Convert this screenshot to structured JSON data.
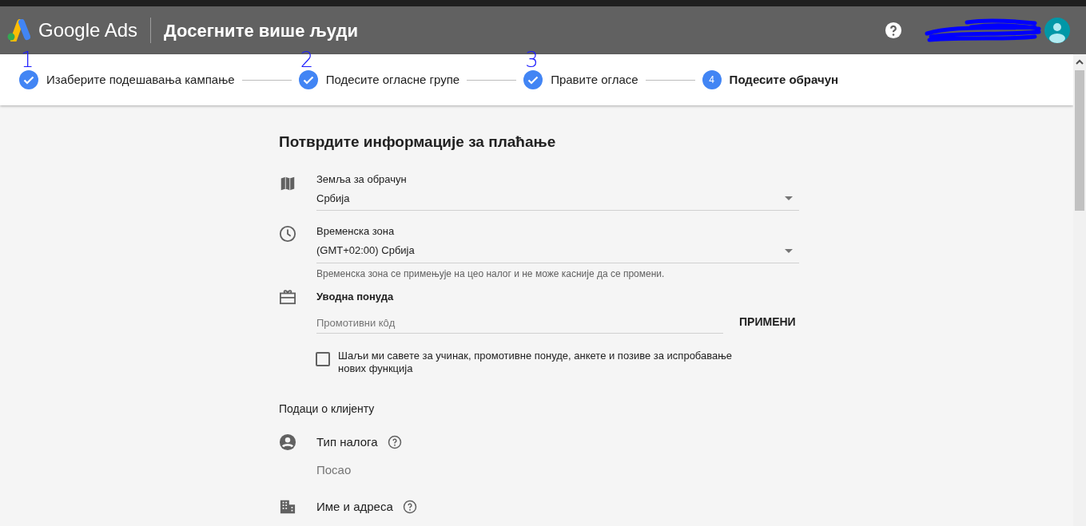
{
  "header": {
    "product": "Google Ads",
    "title": "Досегните више људи"
  },
  "steps": [
    {
      "label": "Изаберите подешавања кампање",
      "completed": true,
      "annotation": "1"
    },
    {
      "label": "Подесите огласне групе",
      "completed": true,
      "annotation": "2"
    },
    {
      "label": "Правите огласе",
      "completed": true,
      "annotation": "3"
    },
    {
      "label": "Подесите обрачун",
      "completed": false,
      "number": "4"
    }
  ],
  "form": {
    "title": "Потврдите информације за плаћање",
    "country": {
      "label": "Земља за обрачун",
      "value": "Србија"
    },
    "timezone": {
      "label": "Временска зона",
      "value": "(GMT+02:00) Србија",
      "hint": "Временска зона се примењује на цео налог и не може касније да се промени."
    },
    "promo": {
      "label": "Уводна понуда",
      "placeholder": "Промотивни кôд",
      "button": "ПРИМЕНИ"
    },
    "newsletter": {
      "label": "Шаљи ми савете за учинак, промотивне понуде, анкете и позиве за испробавање нових функција",
      "checked": false
    },
    "client_section": "Подаци о клијенту",
    "account_type": {
      "label": "Тип налога",
      "value": "Посао"
    },
    "name_address": {
      "label": "Име и адреса"
    }
  }
}
